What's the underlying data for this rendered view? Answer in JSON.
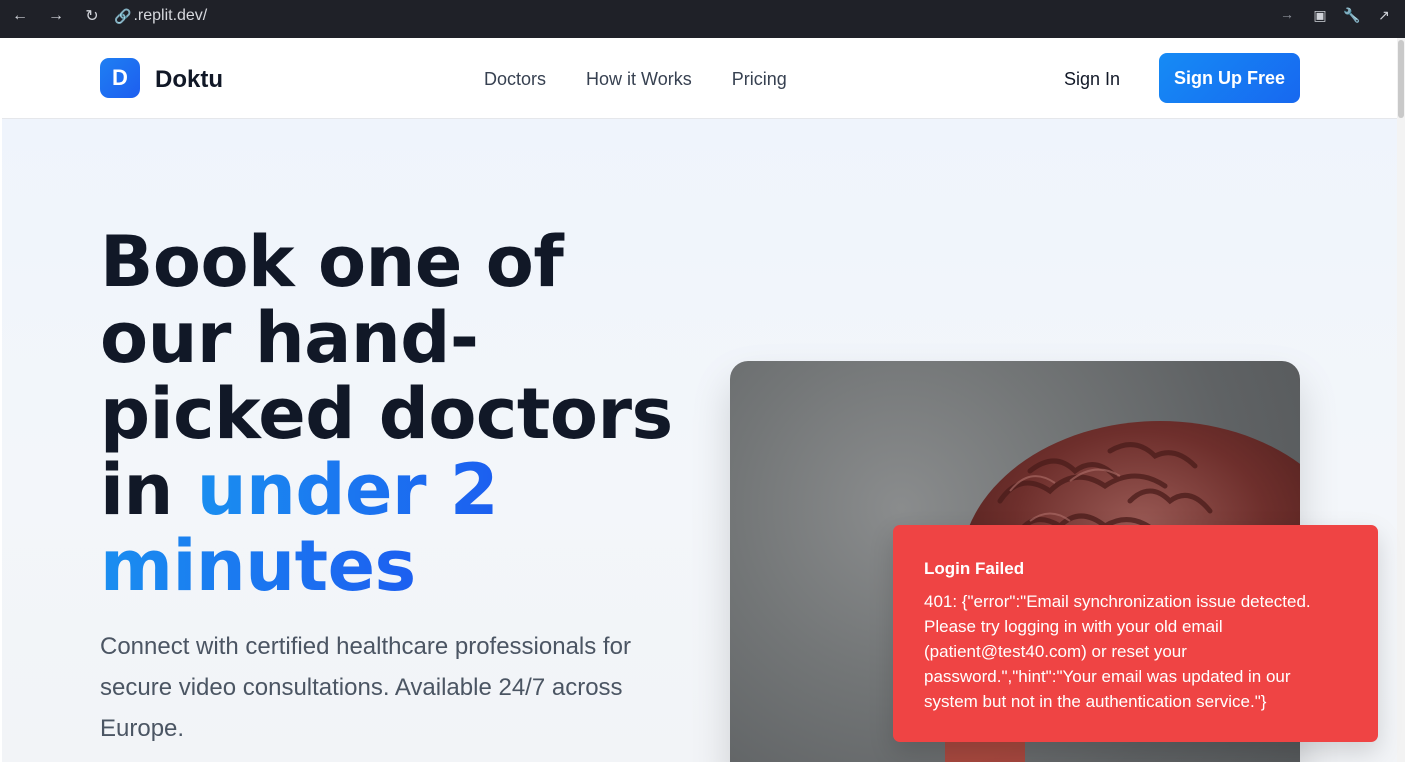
{
  "browser": {
    "url": ".replit.dev/"
  },
  "header": {
    "logo_letter": "D",
    "brand": "Doktu",
    "nav": [
      "Doctors",
      "How it Works",
      "Pricing"
    ],
    "sign_in": "Sign In",
    "sign_up": "Sign Up Free"
  },
  "hero": {
    "title_line1": "Book one of",
    "title_line2": "our hand-",
    "title_line3": "picked doctors",
    "title_in": "in ",
    "title_accent1": "under 2",
    "title_accent2": "minutes",
    "subtitle": "Connect with certified healthcare professionals for secure video consultations. Available 24/7 across Europe."
  },
  "toast": {
    "title": "Login Failed",
    "message": "401: {\"error\":\"Email synchronization issue detected. Please try logging in with your old email (patient@test40.com) or reset your password.\",\"hint\":\"Your email was updated in our system but not in the authentication service.\"}"
  },
  "colors": {
    "accent": "#1779f0",
    "toast_bg": "#ef4444",
    "title": "#111827"
  }
}
